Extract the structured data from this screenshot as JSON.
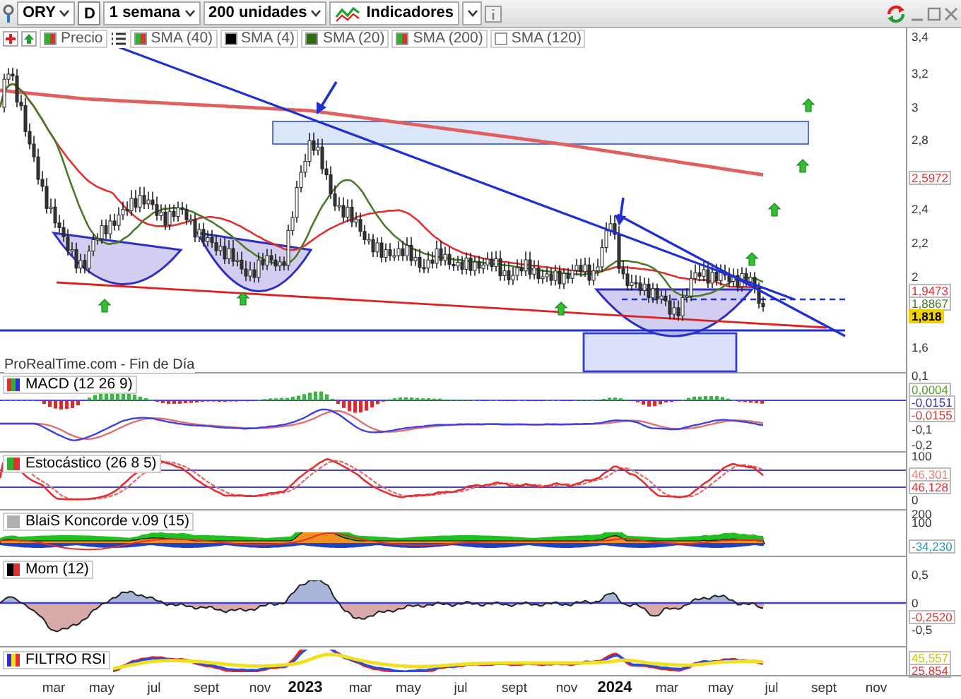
{
  "toolbar": {
    "symbol": "ORY",
    "period_button": "D",
    "timeframe": "1 semana",
    "units": "200 unidades",
    "indicators_button": "Indicadores"
  },
  "legend": [
    {
      "label": "Precio",
      "kind": "split",
      "color": "#e03030"
    },
    {
      "label": "SMA (40)",
      "kind": "split",
      "color": "#e03030"
    },
    {
      "label": "SMA (4)",
      "kind": "solid",
      "color": "#000000"
    },
    {
      "label": "SMA (20)",
      "kind": "solid",
      "color": "#2e6b12"
    },
    {
      "label": "SMA (200)",
      "kind": "split",
      "color": "#e03030"
    },
    {
      "label": "SMA (120)",
      "kind": "solid",
      "color": "#ffffff"
    }
  ],
  "main_chart": {
    "y_ticks": [
      "3,4",
      "3,2",
      "3",
      "2,8",
      "2,4",
      "2,2",
      "2",
      "1,6"
    ],
    "value_labels": [
      {
        "text": "2,5972",
        "color": "#e03030",
        "kind": "boxed"
      },
      {
        "text": "1,9473",
        "color": "#e03030",
        "kind": "boxed"
      },
      {
        "text": "1,8867",
        "color": "#4a7a2a",
        "kind": "boxed"
      },
      {
        "text": "1,818",
        "kind": "filled"
      }
    ],
    "footer_note": "ProRealTime.com - Fin de Día"
  },
  "panels": [
    {
      "title": "MACD (12 26 9)",
      "y_ticks": [
        "0,1",
        "-0,1",
        "-0,2"
      ],
      "value_labels": [
        {
          "text": "0,0004",
          "color": "#5aa02c"
        },
        {
          "text": "-0,0151",
          "color": "#3030c0"
        },
        {
          "text": "-0,0155",
          "color": "#e03030"
        }
      ]
    },
    {
      "title": "Estocástico (26 8 5)",
      "y_ticks": [
        "100",
        "0"
      ],
      "value_labels": [
        {
          "text": "46,301",
          "color": "#e88080"
        },
        {
          "text": "46,128",
          "color": "#e03030"
        }
      ]
    },
    {
      "title": "BlaiS Koncorde v.09 (15)",
      "y_ticks": [
        "200",
        "100"
      ],
      "value_labels": [
        {
          "text": "-34,230",
          "color": "#20a0c0"
        }
      ]
    },
    {
      "title": "Mom (12)",
      "y_ticks": [
        "0,5",
        "0",
        "-0,5"
      ],
      "value_labels": [
        {
          "text": "-0,2520",
          "color": "#e03030"
        }
      ]
    },
    {
      "title": "FILTRO RSI",
      "value_labels": [
        {
          "text": "45,557",
          "color": "#c8c800"
        },
        {
          "text": "25,854",
          "color": "#e03030"
        }
      ]
    }
  ],
  "x_axis": [
    {
      "label": "mar",
      "kind": "month"
    },
    {
      "label": "may",
      "kind": "month"
    },
    {
      "label": "jul",
      "kind": "month"
    },
    {
      "label": "sept",
      "kind": "month"
    },
    {
      "label": "nov",
      "kind": "month"
    },
    {
      "label": "2023",
      "kind": "year"
    },
    {
      "label": "mar",
      "kind": "month"
    },
    {
      "label": "may",
      "kind": "month"
    },
    {
      "label": "jul",
      "kind": "month"
    },
    {
      "label": "sept",
      "kind": "month"
    },
    {
      "label": "nov",
      "kind": "month"
    },
    {
      "label": "2024",
      "kind": "year"
    },
    {
      "label": "mar",
      "kind": "month"
    },
    {
      "label": "may",
      "kind": "month"
    },
    {
      "label": "jul",
      "kind": "month"
    },
    {
      "label": "sept",
      "kind": "month"
    },
    {
      "label": "nov",
      "kind": "month"
    }
  ]
}
